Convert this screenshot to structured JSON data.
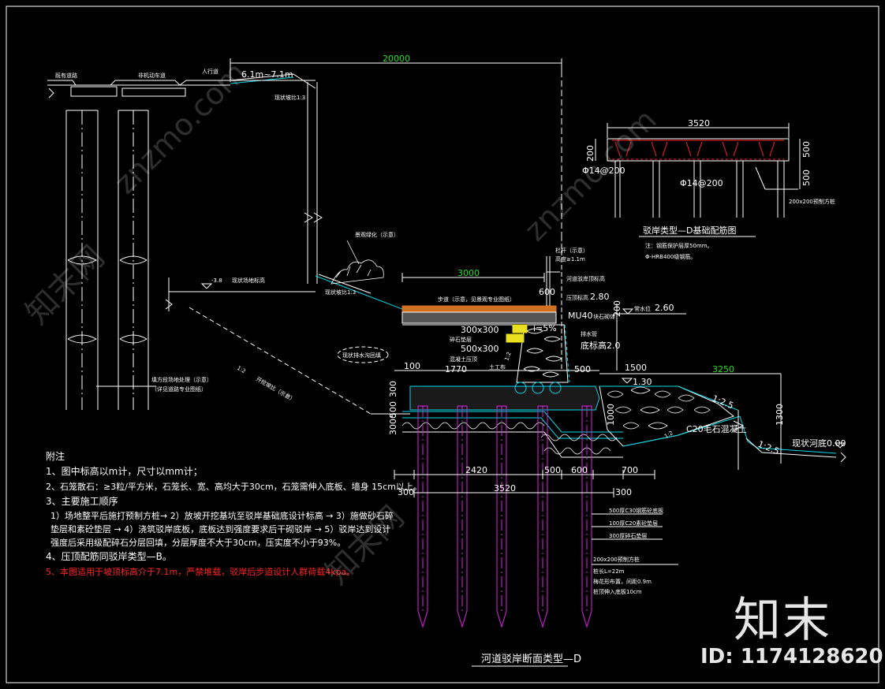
{
  "road": {
    "label_left": "既有道路",
    "label_mid": "非机动车道",
    "label_right": "人行道",
    "slope_top": "6.1m~7.1m",
    "slope_ratio_a": "现状坡比1:3",
    "slope_ratio_b": "现状坡比1:3",
    "width_dim": "20000"
  },
  "section": {
    "ground_level": "-3.8",
    "ground_label": "现状场地标高",
    "existing_slope": "1:2",
    "existing_slope_note": "开挖坡比（示意）",
    "bank_note": "填方段场地处理（示意）",
    "bank_note2": "（详见道路专业图纸）",
    "landscape_note": "景观绿化（示意）",
    "drain_note": "现状排水沟回填",
    "walkway_width": "3000",
    "walkway_label": "步道（示意，见景观专业图纸）",
    "rail_label": "栏杆（示意）",
    "rail_height": "高度≥1.1m",
    "river_top": "河道驳岸顶标高",
    "level_280": "2.80",
    "level_280_label": "压顶标高",
    "mu40": "MU40",
    "mu40_label": "块石砌体",
    "level_260": "2.60",
    "level_260_label": "常水位",
    "gravel_slope": "i=5%",
    "dim_300x300": "300x300",
    "dim_500x300": "500x300",
    "gravel_label": "碎石垫层",
    "gravel_label2": "混凝土压顶",
    "drain_pipe": "排水管",
    "level_200": "底标高2.0",
    "dim_600": "600",
    "dim_200": "200",
    "dim_100_a": "100",
    "dim_1770": "1770",
    "dim_500_a": "500",
    "dim_1500": "1500",
    "dim_3250": "3250",
    "level_130": "1.30",
    "ratio_125_a": "1:2.5",
    "ratio_125_b": "1:2.5",
    "c20_label": "C20毛石混凝土",
    "river_bed": "现状河底0.00",
    "dim_1000": "1000",
    "dim_1300": "1300",
    "dim_300_v": "300",
    "dim_500_v": "500",
    "dim_3000_v": "3000",
    "dim_2420": "2420",
    "dim_500_b": "500",
    "dim_600_b": "600",
    "dim_700": "700",
    "dim_3520": "3520",
    "dim_300_l": "300",
    "dim_300_r": "300",
    "layer_1": "500厚C30钢筋砼底板",
    "layer_2": "100厚C20素砼垫层",
    "layer_3": "300厚碎石垫层",
    "pile": "200x200预制方桩",
    "pile_len": "桩长L=22m",
    "pile_spacing": "梅花形布置，间距0.9m",
    "pile_embed": "桩顶伸入底板10cm",
    "title": "河道驳岸断面类型—D",
    "ratio_12": "1:2",
    "soil_label": "土工布"
  },
  "detail": {
    "width": "3520",
    "dim_200": "200",
    "dim_500_a": "500",
    "dim_500_b": "500",
    "rebar_1": "Φ14@200",
    "rebar_2": "Φ14@200",
    "pile": "200x200预制方桩",
    "title": "驳岸类型—D基础配筋图",
    "note_1": "注：钢筋保护层厚50mm。",
    "note_2": "Φ-HRB400级钢筋。"
  },
  "notes": {
    "heading": "附注",
    "n1": "1、图中标高以m计，尺寸以mm计；",
    "n2": "2、石笼散石：≥3粒/平方米，石笼长、宽、高均大于30cm，石笼需伸入底板、墙身  15cm以上。",
    "n3": "3、主要施工顺序",
    "n3a": "1）场地整平后施打预制方桩→ 2）放坡开挖基坑至驳岸基础底设计标高 → 3）施做砂石碎垫层和素砼垫层 → 4）浇筑驳岸底板，底板达到强度要求后干砌驳岸 → 5）驳岸达到设计强度后采用级配碎石分层回填，分层厚度不大于30cm，压实度不小于93%。",
    "n4": "4、压顶配筋同驳岸类型—B。",
    "n5": "5、本图适用于坡顶标高介于7.1m，严禁堆载，驳岸后步道设计人群荷载4kpa。"
  },
  "branding": {
    "logo": "知末",
    "id": "ID: 1174128620",
    "watermark": "znzmo.com",
    "watermark_cn": "知末网"
  },
  "colors": {
    "bg": "#000000",
    "line": "#ffffff",
    "cyan": "#00d8e8",
    "magenta": "#e020e0",
    "green": "#20e020",
    "red": "#ff2020",
    "yellow": "#e8e020",
    "orange": "#d07020"
  }
}
